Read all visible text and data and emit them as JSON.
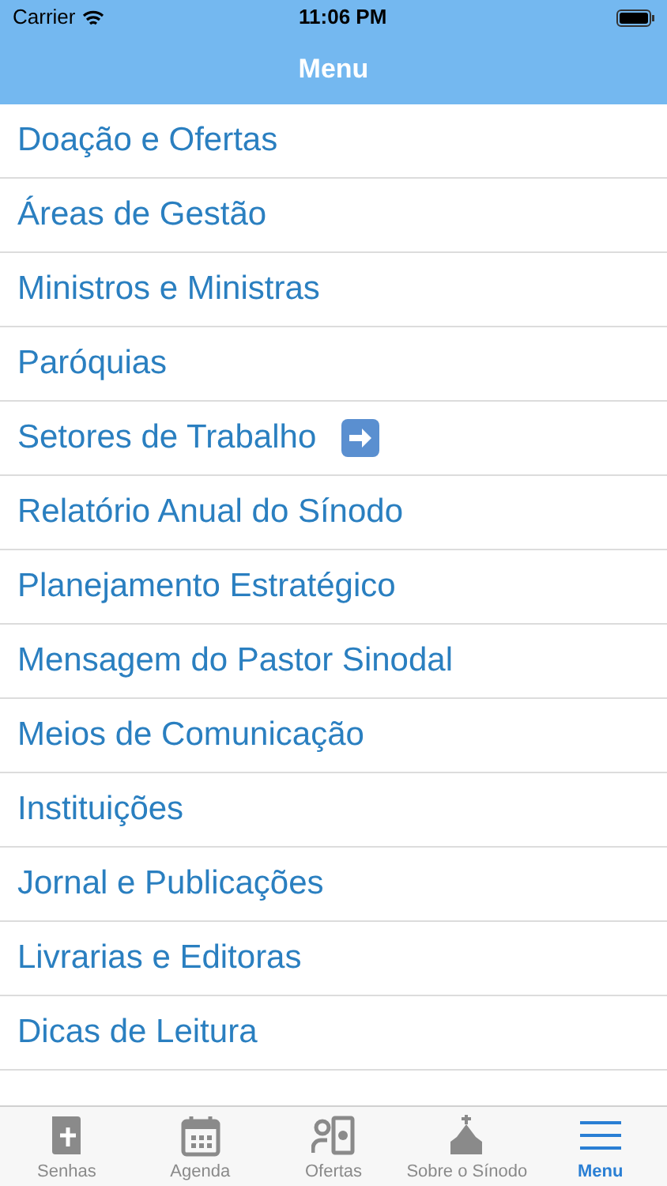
{
  "status_bar": {
    "carrier": "Carrier",
    "time": "11:06 PM"
  },
  "nav_bar": {
    "title": "Menu"
  },
  "menu_items": [
    {
      "label": "Doação e Ofertas",
      "has_arrow": false
    },
    {
      "label": "Áreas de Gestão",
      "has_arrow": false
    },
    {
      "label": "Ministros e Ministras",
      "has_arrow": false
    },
    {
      "label": "Paróquias",
      "has_arrow": false
    },
    {
      "label": "Setores de Trabalho",
      "has_arrow": true
    },
    {
      "label": "Relatório Anual do Sínodo",
      "has_arrow": false
    },
    {
      "label": "Planejamento Estratégico",
      "has_arrow": false
    },
    {
      "label": "Mensagem do Pastor Sinodal",
      "has_arrow": false
    },
    {
      "label": "Meios de Comunicação",
      "has_arrow": false
    },
    {
      "label": "Instituições",
      "has_arrow": false
    },
    {
      "label": "Jornal e Publicações",
      "has_arrow": false
    },
    {
      "label": "Livrarias e Editoras",
      "has_arrow": false
    },
    {
      "label": "Dicas de Leitura",
      "has_arrow": false
    }
  ],
  "tab_bar": [
    {
      "label": "Senhas",
      "kind": "book",
      "selected": false
    },
    {
      "label": "Agenda",
      "kind": "calendar",
      "selected": false
    },
    {
      "label": "Ofertas",
      "kind": "offering",
      "selected": false
    },
    {
      "label": "Sobre o Sínodo",
      "kind": "church",
      "selected": false
    },
    {
      "label": "Menu",
      "kind": "menu",
      "selected": true
    }
  ]
}
